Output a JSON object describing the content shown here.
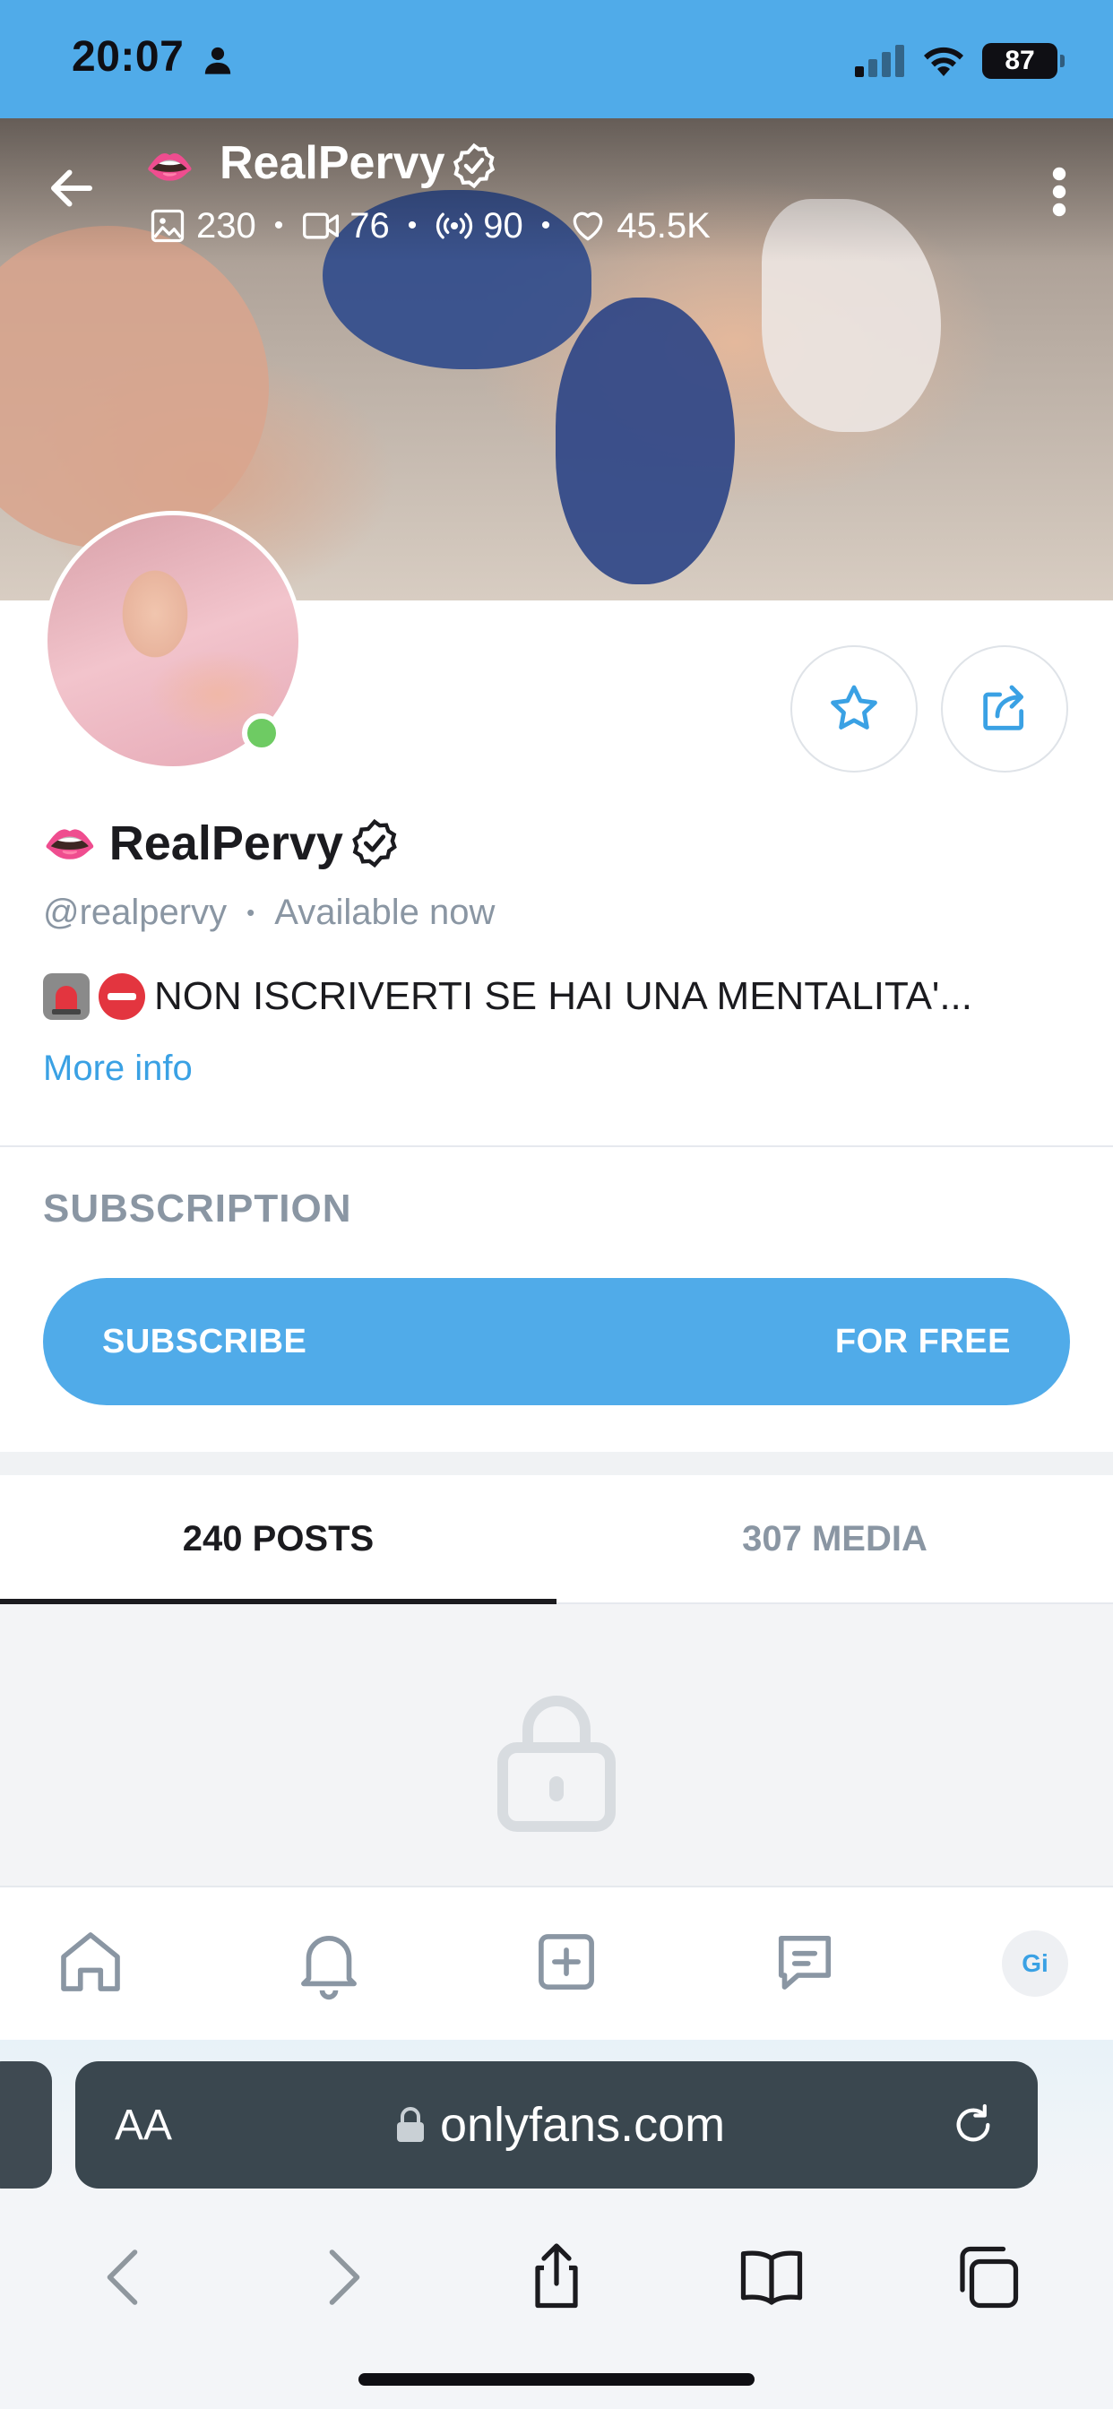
{
  "status_bar": {
    "time": "20:07",
    "battery": "87"
  },
  "profile_header": {
    "name": "RealPervy",
    "lips_emoji": "👄",
    "stats": {
      "photos": "230",
      "videos": "76",
      "streams": "90",
      "likes": "45.5K"
    }
  },
  "profile": {
    "name": "RealPervy",
    "lips_emoji": "👄",
    "handle": "@realpervy",
    "availability": "Available now",
    "bio": "NON ISCRIVERTI SE HAI UNA MENTALITA'...",
    "more_info": "More info"
  },
  "subscription": {
    "title": "SUBSCRIPTION",
    "button_label": "SUBSCRIBE",
    "button_price": "FOR FREE"
  },
  "tabs": [
    {
      "label": "240 POSTS",
      "active": true
    },
    {
      "label": "307 MEDIA",
      "active": false
    }
  ],
  "bottom_nav": {
    "avatar_initials": "Gi"
  },
  "safari": {
    "aa_label": "AA",
    "url": "onlyfans.com"
  },
  "colors": {
    "accent": "#50abe9",
    "link": "#3aa1e4",
    "online": "#6ecb63",
    "muted": "#8a96a3"
  }
}
